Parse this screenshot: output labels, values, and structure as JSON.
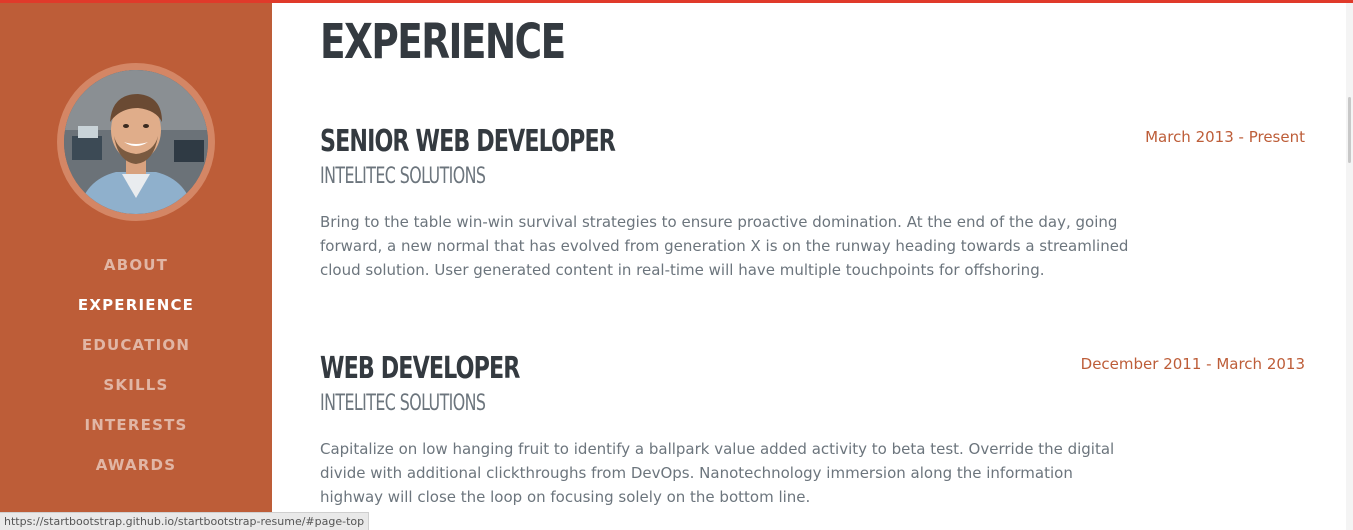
{
  "colors": {
    "sidebar": "#bd5d38",
    "accent": "#bd5d38",
    "top_bar": "#e03a2a",
    "heading": "#343a40",
    "muted_text": "#6c757d"
  },
  "sidebar": {
    "avatar_icon": "profile-photo",
    "nav": [
      {
        "label": "ABOUT",
        "active": false
      },
      {
        "label": "EXPERIENCE",
        "active": true
      },
      {
        "label": "EDUCATION",
        "active": false
      },
      {
        "label": "SKILLS",
        "active": false
      },
      {
        "label": "INTERESTS",
        "active": false
      },
      {
        "label": "AWARDS",
        "active": false
      }
    ]
  },
  "main": {
    "section_title": "EXPERIENCE",
    "jobs": [
      {
        "title": "SENIOR WEB DEVELOPER",
        "company": "INTELITEC SOLUTIONS",
        "date": "March 2013 - Present",
        "description": "Bring to the table win-win survival strategies to ensure proactive domination. At the end of the day, going forward, a new normal that has evolved from generation X is on the runway heading towards a streamlined cloud solution. User generated content in real-time will have multiple touchpoints for offshoring."
      },
      {
        "title": "WEB DEVELOPER",
        "company": "INTELITEC SOLUTIONS",
        "date": "December 2011 - March 2013",
        "description": "Capitalize on low hanging fruit to identify a ballpark value added activity to beta test. Override the digital divide with additional clickthroughs from DevOps. Nanotechnology immersion along the information highway will close the loop on focusing solely on the bottom line."
      }
    ]
  },
  "status_bar": {
    "url": "https://startbootstrap.github.io/startbootstrap-resume/#page-top"
  }
}
